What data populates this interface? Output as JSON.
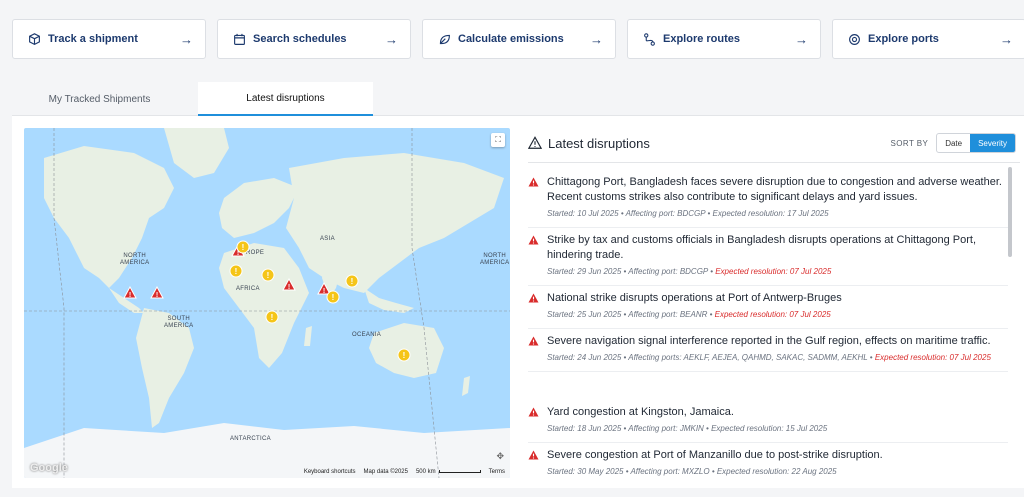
{
  "actions": [
    {
      "label": "Track a shipment",
      "icon": "package-icon"
    },
    {
      "label": "Search schedules",
      "icon": "calendar-icon"
    },
    {
      "label": "Calculate emissions",
      "icon": "leaf-icon"
    },
    {
      "label": "Explore routes",
      "icon": "route-icon"
    },
    {
      "label": "Explore ports",
      "icon": "port-icon"
    }
  ],
  "tabs": [
    "My Tracked Shipments",
    "Latest disruptions"
  ],
  "active_tab": 1,
  "map": {
    "labels": {
      "north_america": "NORTH\nAMERICA",
      "south_america": "SOUTH\nAMERICA",
      "europe": "ROPE",
      "asia": "ASIA",
      "africa": "AFRICA",
      "oceania": "OCEANIA",
      "antarctica": "ANTARCTICA",
      "north_america_right": "NORTH\nAMERICA"
    },
    "google": "Google",
    "footer": {
      "shortcuts": "Keyboard shortcuts",
      "map_data": "Map data ©2025",
      "scale": "500 km",
      "terms": "Terms"
    }
  },
  "disruptions_header": {
    "title": "Latest disruptions",
    "sort_by": "SORT BY",
    "sort_options": [
      "Date",
      "Severity"
    ],
    "active_sort": "Severity"
  },
  "disruptions": [
    {
      "title": "Chittagong Port, Bangladesh faces severe disruption due to congestion and adverse weather. Recent customs strikes also contribute to significant delays and yard issues.",
      "started": "Started: 10 Jul 2025",
      "port": "Affecting port: BDCGP",
      "resolution": "Expected resolution: 17 Jul 2025",
      "late": false
    },
    {
      "title": "Strike by tax and customs officials in Bangladesh disrupts operations at Chittagong Port, hindering trade.",
      "started": "Started: 29 Jun 2025",
      "port": "Affecting port: BDCGP",
      "resolution": "Expected resolution: 07 Jul 2025",
      "late": true
    },
    {
      "title": "National strike disrupts operations at Port of Antwerp-Bruges",
      "started": "Started: 25 Jun 2025",
      "port": "Affecting port: BEANR",
      "resolution": "Expected resolution: 07 Jul 2025",
      "late": true
    },
    {
      "title": "Severe navigation signal interference reported in the Gulf region, effects on maritime traffic.",
      "started": "Started: 24 Jun 2025",
      "port": "Affecting ports: AEKLF, AEJEA, QAHMD, SAKAC, SADMM, AEKHL",
      "resolution": "Expected resolution: 07 Jul 2025",
      "late": true
    },
    {
      "title": "Yard congestion at Kingston, Jamaica.",
      "started": "Started: 18 Jun 2025",
      "port": "Affecting port: JMKIN",
      "resolution": "Expected resolution: 15 Jul 2025",
      "late": false
    },
    {
      "title": "Severe congestion at Port of Manzanillo due to post-strike disruption.",
      "started": "Started: 30 May 2025",
      "port": "Affecting port: MXZLO",
      "resolution": "Expected resolution: 22 Aug 2025",
      "late": false
    }
  ],
  "colors": {
    "accent": "#1f8fdb",
    "danger": "#d92c2c",
    "warning": "#f5c518",
    "navy": "#1d3a6e",
    "water": "#aadaff",
    "land": "#e8f0e4"
  }
}
